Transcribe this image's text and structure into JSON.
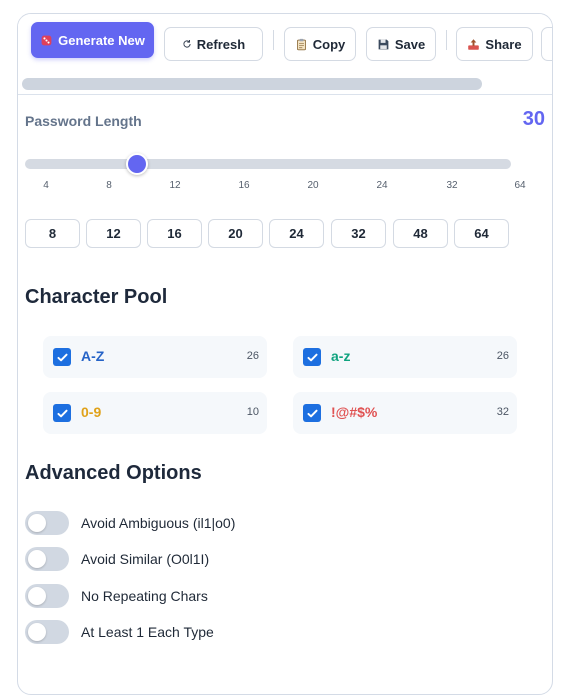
{
  "toolbar": {
    "generate_label": "Generate New",
    "refresh_label": "Refresh",
    "copy_label": "Copy",
    "save_label": "Save",
    "share_label": "Share",
    "icons": {
      "generate": "dice-icon",
      "refresh": "refresh-icon",
      "copy": "clipboard-icon",
      "save": "floppy-disk-icon",
      "share": "upload-tray-icon"
    }
  },
  "length": {
    "label": "Password Length",
    "value": "30",
    "slider": {
      "min": 4,
      "max": 64,
      "current": 17
    },
    "ticks": [
      "4",
      "8",
      "12",
      "16",
      "20",
      "24",
      "32",
      "64"
    ],
    "presets": [
      "8",
      "12",
      "16",
      "20",
      "24",
      "32",
      "48",
      "64"
    ]
  },
  "pool": {
    "title": "Character Pool",
    "items": [
      {
        "label": "A-Z",
        "count": "26",
        "checked": true,
        "color": "#2563c7"
      },
      {
        "label": "a-z",
        "count": "26",
        "checked": true,
        "color": "#10a37f"
      },
      {
        "label": "0-9",
        "count": "10",
        "checked": true,
        "color": "#e0a21a"
      },
      {
        "label": "!@#$%",
        "count": "32",
        "checked": true,
        "color": "#e05252"
      }
    ]
  },
  "advanced": {
    "title": "Advanced Options",
    "options": [
      {
        "label": "Avoid Ambiguous (il1|o0)",
        "on": false
      },
      {
        "label": "Avoid Similar (O0l1I)",
        "on": false
      },
      {
        "label": "No Repeating Chars",
        "on": false
      },
      {
        "label": "At Least 1 Each Type",
        "on": false
      }
    ]
  },
  "colors": {
    "accent": "#6366f1",
    "checkbox": "#1d6fe0"
  }
}
